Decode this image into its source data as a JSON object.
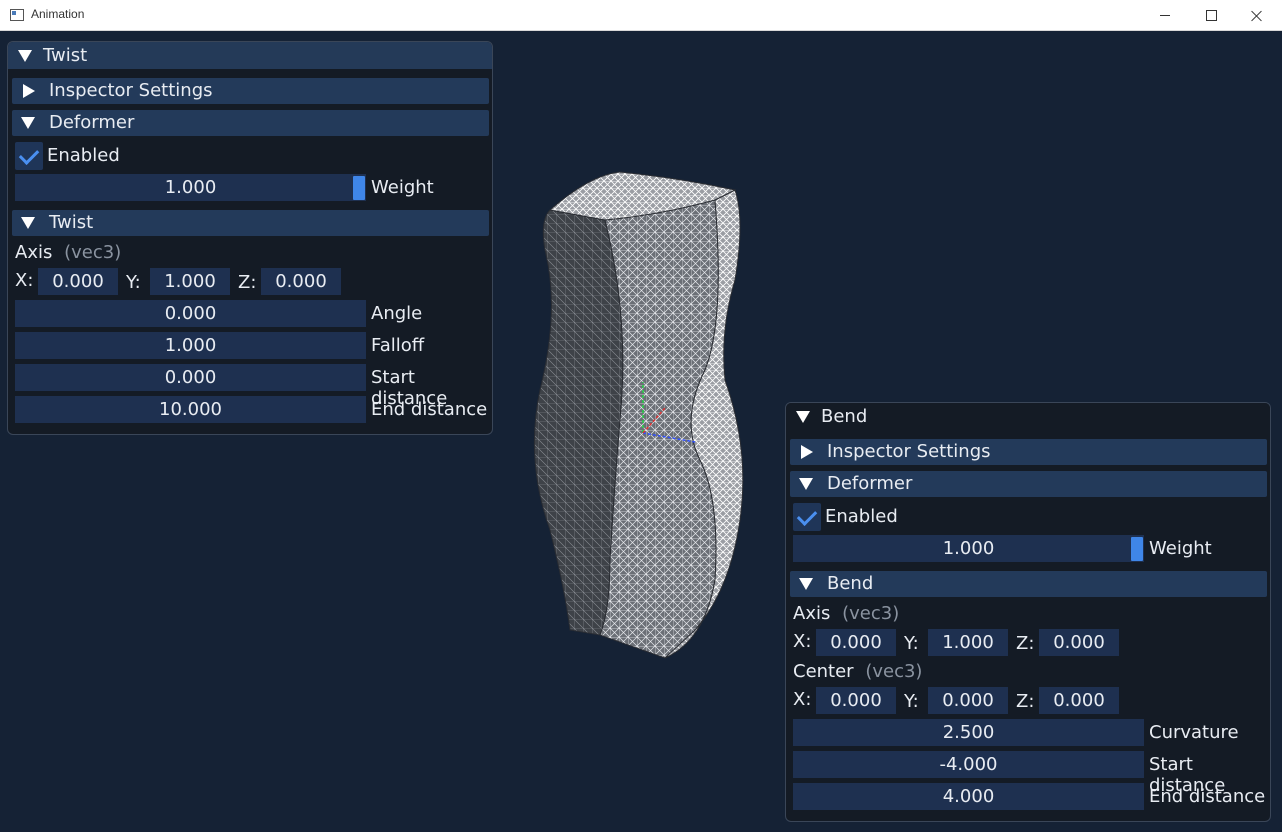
{
  "window": {
    "title": "Animation"
  },
  "twist_panel": {
    "title": "Twist",
    "inspector_label": "Inspector Settings",
    "deformer_label": "Deformer",
    "enabled_label": "Enabled",
    "enabled": true,
    "weight_value": "1.000",
    "weight_label": "Weight",
    "section_label": "Twist",
    "axis_label": "Axis",
    "axis_type": "(vec3)",
    "axis_x_label": "X:",
    "axis_x": "0.000",
    "axis_y_label": "Y:",
    "axis_y": "1.000",
    "axis_z_label": "Z:",
    "axis_z": "0.000",
    "angle_value": "0.000",
    "angle_label": "Angle",
    "falloff_value": "1.000",
    "falloff_label": "Falloff",
    "start_value": "0.000",
    "start_label": "Start distance",
    "end_value": "10.000",
    "end_label": "End distance"
  },
  "bend_panel": {
    "title": "Bend",
    "inspector_label": "Inspector Settings",
    "deformer_label": "Deformer",
    "enabled_label": "Enabled",
    "enabled": true,
    "weight_value": "1.000",
    "weight_label": "Weight",
    "section_label": "Bend",
    "axis_label": "Axis",
    "axis_type": "(vec3)",
    "axis_x_label": "X:",
    "axis_x": "0.000",
    "axis_y_label": "Y:",
    "axis_y": "1.000",
    "axis_z_label": "Z:",
    "axis_z": "0.000",
    "center_label": "Center",
    "center_type": "(vec3)",
    "center_x_label": "X:",
    "center_x": "0.000",
    "center_y_label": "Y:",
    "center_y": "0.000",
    "center_z_label": "Z:",
    "center_z": "0.000",
    "curvature_value": "2.500",
    "curvature_label": "Curvature",
    "start_value": "-4.000",
    "start_label": "Start distance",
    "end_value": "4.000",
    "end_label": "End distance"
  },
  "colors": {
    "background": "#152235",
    "header": "#243a58",
    "field": "#1e3050",
    "accent": "#3f86e8"
  }
}
